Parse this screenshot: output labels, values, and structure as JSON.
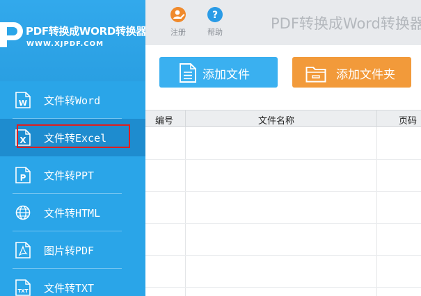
{
  "brand": {
    "app_name": "PDF转换成WORD转换器",
    "url": "WWW.XJPDF.COM",
    "logo_icon": "pdf-logo-icon"
  },
  "menu": {
    "items": [
      {
        "label": "文件转Word",
        "icon": "word-file-icon"
      },
      {
        "label": "文件转Excel",
        "icon": "excel-file-icon",
        "active": true
      },
      {
        "label": "文件转PPT",
        "icon": "ppt-file-icon"
      },
      {
        "label": "文件转HTML",
        "icon": "globe-icon"
      },
      {
        "label": "图片转PDF",
        "icon": "pdf-file-icon"
      },
      {
        "label": "文件转TXT",
        "icon": "txt-file-icon"
      }
    ]
  },
  "topbar": {
    "register_label": "注册",
    "help_label": "帮助",
    "title": "PDF转换成Word转换器"
  },
  "actions": {
    "add_file_label": "添加文件",
    "add_folder_label": "添加文件夹"
  },
  "table": {
    "columns": [
      "编号",
      "文件名称",
      "页码"
    ]
  },
  "colors": {
    "sidebar": "#2aa5e8",
    "active_item": "#1e8ccf",
    "add_file_button": "#3ab0f0",
    "add_folder_button": "#f29a3a",
    "highlight_box": "#e01e1e"
  }
}
